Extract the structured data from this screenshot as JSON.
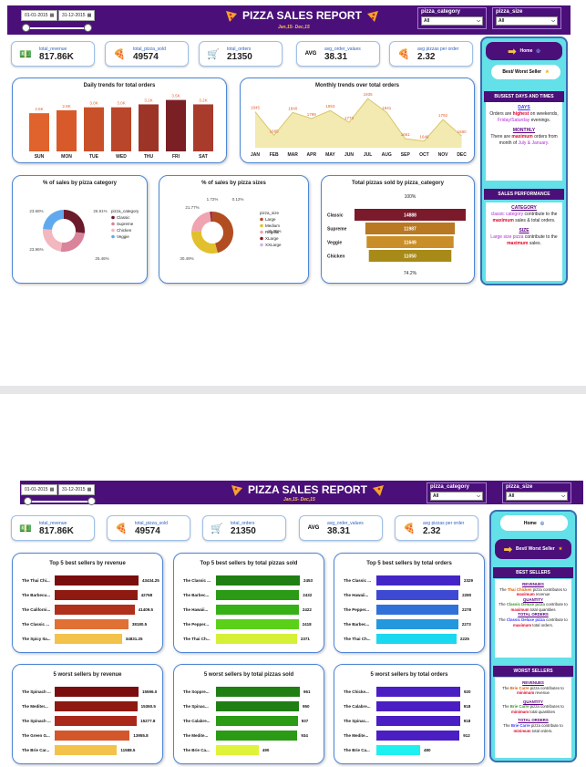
{
  "report": {
    "date_from": "01-01-2015",
    "date_to": "31-12-2015",
    "title": "PIZZA SALES REPORT",
    "subtitle": "Jan,15- Dec,15",
    "filter_category": {
      "label": "pizza_category",
      "value": "All"
    },
    "filter_size": {
      "label": "pizza_size",
      "value": "All"
    }
  },
  "kpis": [
    {
      "label": "total_revenue",
      "value": "817.86K",
      "icon": "money-icon"
    },
    {
      "label": "total_pizza_sold",
      "value": "49574",
      "icon": "pizza-icon"
    },
    {
      "label": "total_orders",
      "value": "21350",
      "icon": "cart-icon"
    },
    {
      "label": "avg_order_values",
      "value": "38.31",
      "icon": "avg-icon"
    },
    {
      "label": "avg pizzas per order",
      "value": "2.32",
      "icon": "pizza-slice-icon"
    }
  ],
  "page1": {
    "nav": {
      "home": "Home",
      "best_worst": "Best/ Worst Seller"
    },
    "busiest": {
      "header": "BUSIEST DAYS AND TIMES",
      "days_title": "DAYS",
      "days_text_a": "Orders are ",
      "days_text_hi": "highest",
      "days_text_b": " on weekends, ",
      "days_text_c": "Friday/Saturday",
      "days_text_d": " evenings.",
      "monthly_title": "MONTHLY",
      "monthly_a": "There are ",
      "monthly_hi": "maximum",
      "monthly_b": " orders from  month of ",
      "monthly_c": "July & January."
    },
    "performance": {
      "header": "SALES PERFORMANCE",
      "cat_title": "CATEGORY",
      "cat_a": "classic category",
      "cat_b": " contribute to the ",
      "cat_hi": "maximum",
      "cat_c": " sales & total orders.",
      "size_title": "SIZE",
      "size_a": "Large size pizza",
      "size_b": " contribute to the ",
      "size_hi": "maximum",
      "size_c": " sales."
    }
  },
  "page2": {
    "nav": {
      "home": "Home",
      "best_worst": "Best/ Worst Seller"
    },
    "best": {
      "header": "BEST SELLERS",
      "rev_title": "REVENUES",
      "rev_a": "The ",
      "rev_hi": "Thai Chicken",
      "rev_b": " pizza contributes to ",
      "rev_max": "maximum",
      "rev_c": " revenue",
      "qty_title": "QUANTITY",
      "qty_a": "The ",
      "qty_hi": "Classic Deluxe pizza",
      "qty_b": " contribute to ",
      "qty_max": "maximum",
      "qty_c": " total quantities",
      "ord_title": "TOTAL ORDERS",
      "ord_a": "The ",
      "ord_hi": "Classic Deluxe pizza",
      "ord_b": " contribute to ",
      "ord_max": "maximum",
      "ord_c": " total orders."
    },
    "worst": {
      "header": "WORST SELLERS",
      "rev_title": "REVENUES",
      "rev_a": "The ",
      "rev_hi": "Brie Carre",
      "rev_b": " pizza contributes to ",
      "rev_min": "minimum",
      "rev_c": " revenue",
      "qty_title": "QUANTITY",
      "qty_a": "The ",
      "qty_hi": "Brie Carre",
      "qty_b": " pizza contributes to ",
      "qty_min": "minimum",
      "qty_c": " total quantities",
      "ord_title": "TOTAL ORDERS",
      "ord_a": "The ",
      "ord_hi": "Brie Carre",
      "ord_b": " pizza contribute to ",
      "ord_min": "minimum",
      "ord_c": " total orders."
    }
  },
  "chart_data": [
    {
      "type": "bar",
      "title": "Daily trends for total orders",
      "categories": [
        "SUN",
        "MON",
        "TUE",
        "WED",
        "THU",
        "FRI",
        "SAT"
      ],
      "values": [
        2.6,
        2.8,
        3.0,
        3.0,
        3.2,
        3.5,
        3.2
      ],
      "labels": [
        "2.6K",
        "2.8K",
        "3.0K",
        "3.0K",
        "3.2K",
        "3.5K",
        "3.2K"
      ],
      "colors": [
        "#e0622c",
        "#d85a2a",
        "#c9512a",
        "#b9452a",
        "#9c3428",
        "#7a1f24",
        "#a83b2c"
      ]
    },
    {
      "type": "area",
      "title": "Monthly trends over total orders",
      "categories": [
        "JAN",
        "FEB",
        "MAR",
        "APR",
        "MAY",
        "JUN",
        "JUL",
        "AUG",
        "SEP",
        "OCT",
        "NOV",
        "DEC"
      ],
      "values": [
        1845,
        1685,
        1840,
        1799,
        1853,
        1773,
        1935,
        1841,
        1661,
        1646,
        1792,
        1680
      ]
    },
    {
      "type": "pie",
      "title": "% of sales by pizza category",
      "legend_title": "pizza_category",
      "slices": [
        {
          "name": "Classic",
          "value": 26.91,
          "label": "26.91%",
          "color": "#6b1a2c"
        },
        {
          "name": "Supreme",
          "value": 25.46,
          "label": "25.46%",
          "color": "#d9849a"
        },
        {
          "name": "Chicken",
          "value": 23.96,
          "label": "23.96%",
          "color": "#f2b7bf"
        },
        {
          "name": "Veggie",
          "value": 23.68,
          "label": "23.68%",
          "color": "#61a9ef"
        }
      ]
    },
    {
      "type": "pie",
      "title": "% of sales by pizza sizes",
      "legend_title": "pizza_size",
      "slices": [
        {
          "name": "Large",
          "value": 45.89,
          "label": "45.89%",
          "color": "#b24d22"
        },
        {
          "name": "Medium",
          "value": 30.49,
          "label": "30.49%",
          "color": "#e2c02d"
        },
        {
          "name": "Regular",
          "value": 21.77,
          "label": "21.77%",
          "color": "#f0a3b0"
        },
        {
          "name": "XLarge",
          "value": 1.72,
          "label": "1.72%",
          "color": "#8a1a2a"
        },
        {
          "name": "XXLarge",
          "value": 0.12,
          "label": "0.12%",
          "color": "#d7aee8"
        }
      ]
    },
    {
      "type": "funnel",
      "title": "Total pizzas sold by pizza_category",
      "top_label": "100%",
      "bottom_label": "74.2%",
      "categories": [
        "Classic",
        "Supreme",
        "Veggie",
        "Chicken"
      ],
      "values": [
        14888,
        11987,
        11649,
        11050
      ],
      "colors": [
        "#7a1a2a",
        "#b97822",
        "#c98e27",
        "#a88a18"
      ]
    },
    {
      "type": "bar",
      "orientation": "horizontal",
      "title": "Top 5 best sellers by revenue",
      "categories": [
        "The Thai Chi...",
        "The Barbecu...",
        "The Californi...",
        "The Classic ...",
        "The Spicy Ita..."
      ],
      "values": [
        43434.25,
        42768,
        41409.5,
        38180.5,
        34831.25
      ],
      "labels": [
        "43434.25",
        "42768",
        "41409.5",
        "38180.5",
        "34831.25"
      ],
      "colors": [
        "#7a0d0d",
        "#8e1a12",
        "#b0301b",
        "#e07033",
        "#f2c24b"
      ]
    },
    {
      "type": "bar",
      "orientation": "horizontal",
      "title": "Top 5 best sellers by total pizzas sold",
      "categories": [
        "The Classic ...",
        "The Barbec...",
        "The Hawaii...",
        "The Pepper...",
        "The Thai Ch..."
      ],
      "values": [
        2453,
        2432,
        2422,
        2418,
        2371
      ],
      "labels": [
        "2453",
        "2432",
        "2422",
        "2418",
        "2371"
      ],
      "colors": [
        "#1f7f12",
        "#2b9a14",
        "#35b117",
        "#5bd01a",
        "#d5f036"
      ]
    },
    {
      "type": "bar",
      "orientation": "horizontal",
      "title": "Top 5 best sellers by total orders",
      "categories": [
        "The Classic ...",
        "The Hawaii...",
        "The Pepper...",
        "The Barbec...",
        "The Thai Ch..."
      ],
      "values": [
        2329,
        2280,
        2278,
        2273,
        2225
      ],
      "labels": [
        "2329",
        "2280",
        "2278",
        "2273",
        "2225"
      ],
      "colors": [
        "#4325c7",
        "#3d49d2",
        "#2f71d8",
        "#2598dd",
        "#1ad8ee"
      ]
    },
    {
      "type": "bar",
      "orientation": "horizontal",
      "title": "5 worst sellers by revenue",
      "categories": [
        "The Spinach ...",
        "The Mediter...",
        "The Spinach ...",
        "The Green G...",
        "The Brie Car..."
      ],
      "values": [
        15596,
        15360.5,
        15277.8,
        13955.8,
        11588.5
      ],
      "labels": [
        "15596.0",
        "15360.5",
        "15277.8",
        "13955.8",
        "11588.5"
      ],
      "colors": [
        "#7a0d0d",
        "#8e1a12",
        "#a9281a",
        "#d4572c",
        "#f2c24b"
      ]
    },
    {
      "type": "bar",
      "orientation": "horizontal",
      "title": "5 worst sellers by total pizzas sold",
      "categories": [
        "The Soppre...",
        "The Spinac...",
        "The Calabre...",
        "The Medite...",
        "The Brie Ca..."
      ],
      "values": [
        961,
        950,
        937,
        934,
        490
      ],
      "labels": [
        "961",
        "950",
        "937",
        "934",
        "490"
      ],
      "colors": [
        "#1f7f12",
        "#1f7f12",
        "#2b9a14",
        "#2b9a14",
        "#dff33a"
      ]
    },
    {
      "type": "bar",
      "orientation": "horizontal",
      "title": "5 worst sellers by total orders",
      "categories": [
        "The Chicke...",
        "The Calabre...",
        "The Spinac...",
        "The Medite...",
        "The Brie Ca..."
      ],
      "values": [
        920,
        918,
        918,
        912,
        480
      ],
      "labels": [
        "920",
        "918",
        "918",
        "912",
        "480"
      ],
      "colors": [
        "#4a1ec3",
        "#4a1ec3",
        "#4a1ec3",
        "#4a1ec3",
        "#1ef0f0"
      ]
    }
  ]
}
